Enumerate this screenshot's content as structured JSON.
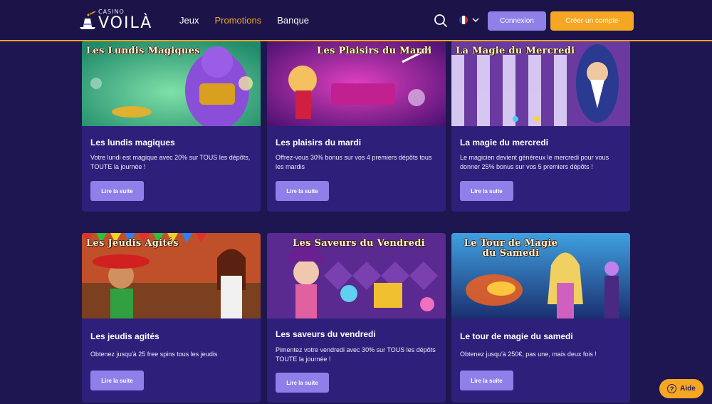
{
  "header": {
    "logo_small": "CASINO",
    "logo_big": "VOILÀ",
    "nav": [
      "Jeux",
      "Promotions",
      "Banque"
    ],
    "active_nav": "Promotions",
    "login_label": "Connexion",
    "signup_label": "Créer un compte",
    "accent_color": "#f5a623",
    "button_color": "#8f7fe8"
  },
  "promotions": [
    {
      "banner": "Les Lundis Magiques",
      "title": "Les lundis magiques",
      "desc": "Votre lundi est magique avec 20% sur TOUS les dépôts, TOUTE la journée !",
      "button": "Lire la suite"
    },
    {
      "banner": "Les Plaisirs du Mardi",
      "title": "Les plaisirs du mardi",
      "desc": "Offrez-vous 30% bonus sur vos 4 premiers dépôts tous les mardis",
      "button": "Lire la suite"
    },
    {
      "banner": "La Magie du Mercredi",
      "title": "La magie du mercredi",
      "desc": "Le magicien devient généreux le mercredi pour vous donner 25% bonus sur vos 5 premiers dépôts !",
      "button": "Lire la suite"
    },
    {
      "banner": "Les Jeudis Agités",
      "title": "Les jeudis agités",
      "desc": "Obtenez jusqu'à 25 free spins tous les jeudis",
      "button": "Lire la suite"
    },
    {
      "banner": "Les Saveurs du Vendredi",
      "title": "Les saveurs du vendredi",
      "desc": "Pimentez votre vendredi avec 30% sur TOUS les dépôts TOUTE la journée !",
      "button": "Lire la suite"
    },
    {
      "banner": "Le Tour de Magie du Samedi",
      "title": "Le tour de magie du samedi",
      "desc": "Obtenez jusqu'à 250€, pas une, mais deux fois !",
      "button": "Lire la suite"
    }
  ],
  "help": {
    "label": "Aide"
  }
}
